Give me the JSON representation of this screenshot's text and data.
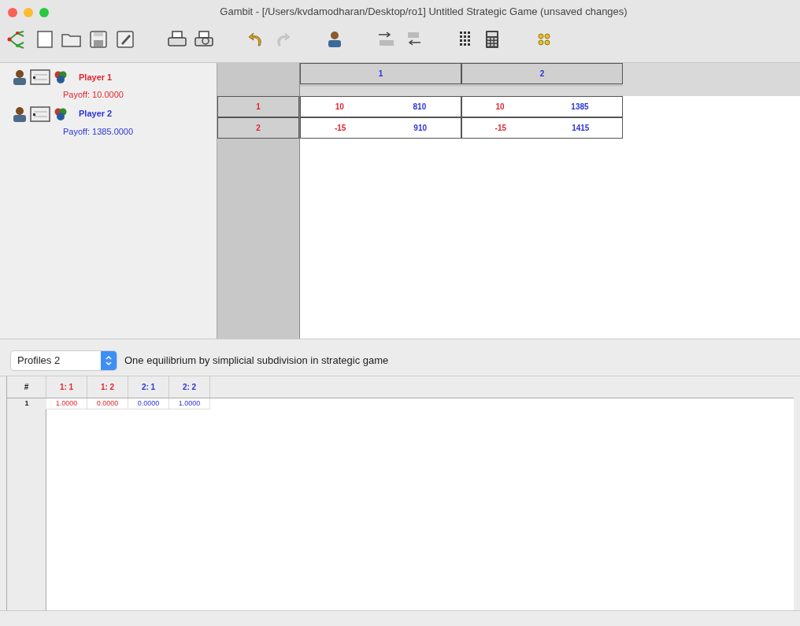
{
  "window": {
    "title": "Gambit - [/Users/kvdamodharan/Desktop/ro1] Untitled Strategic Game (unsaved changes)"
  },
  "toolbar": [
    {
      "kind": "logo"
    },
    {
      "kind": "new"
    },
    {
      "kind": "open"
    },
    {
      "kind": "save"
    },
    {
      "kind": "saveas"
    },
    {
      "kind": "gap"
    },
    {
      "kind": "print"
    },
    {
      "kind": "preview"
    },
    {
      "kind": "gap"
    },
    {
      "kind": "undo",
      "disabled": false
    },
    {
      "kind": "redo",
      "disabled": true
    },
    {
      "kind": "gap"
    },
    {
      "kind": "player"
    },
    {
      "kind": "gap"
    },
    {
      "kind": "decimals"
    },
    {
      "kind": "decimals2"
    },
    {
      "kind": "gap"
    },
    {
      "kind": "reduce"
    },
    {
      "kind": "calc"
    },
    {
      "kind": "gap"
    },
    {
      "kind": "dots"
    }
  ],
  "players": [
    {
      "name": "Player 1",
      "payoff": "Payoff: 10.0000",
      "color": "#e3262c"
    },
    {
      "name": "Player 2",
      "payoff": "Payoff: 1385.0000",
      "color": "#2b35d8"
    }
  ],
  "matrix": {
    "column_strategies": [
      "1",
      "2"
    ],
    "row_strategies": [
      "1",
      "2"
    ],
    "rows": [
      [
        [
          "10",
          "810"
        ],
        [
          "10",
          "1385"
        ]
      ],
      [
        [
          "-15",
          "910"
        ],
        [
          "-15",
          "1415"
        ]
      ]
    ]
  },
  "profiles": {
    "selector": "Profiles 2",
    "description": "One equilibrium by simplicial subdivision in strategic game",
    "columns": [
      {
        "label": "#",
        "color": "#222222"
      },
      {
        "label": "1: 1",
        "color": "#e3262c"
      },
      {
        "label": "1: 2",
        "color": "#e3262c"
      },
      {
        "label": "2: 1",
        "color": "#2b35d8"
      },
      {
        "label": "2: 2",
        "color": "#2b35d8"
      }
    ],
    "rows": [
      [
        "1",
        "1.0000",
        "0.0000",
        "0.0000",
        "1.0000"
      ]
    ]
  }
}
